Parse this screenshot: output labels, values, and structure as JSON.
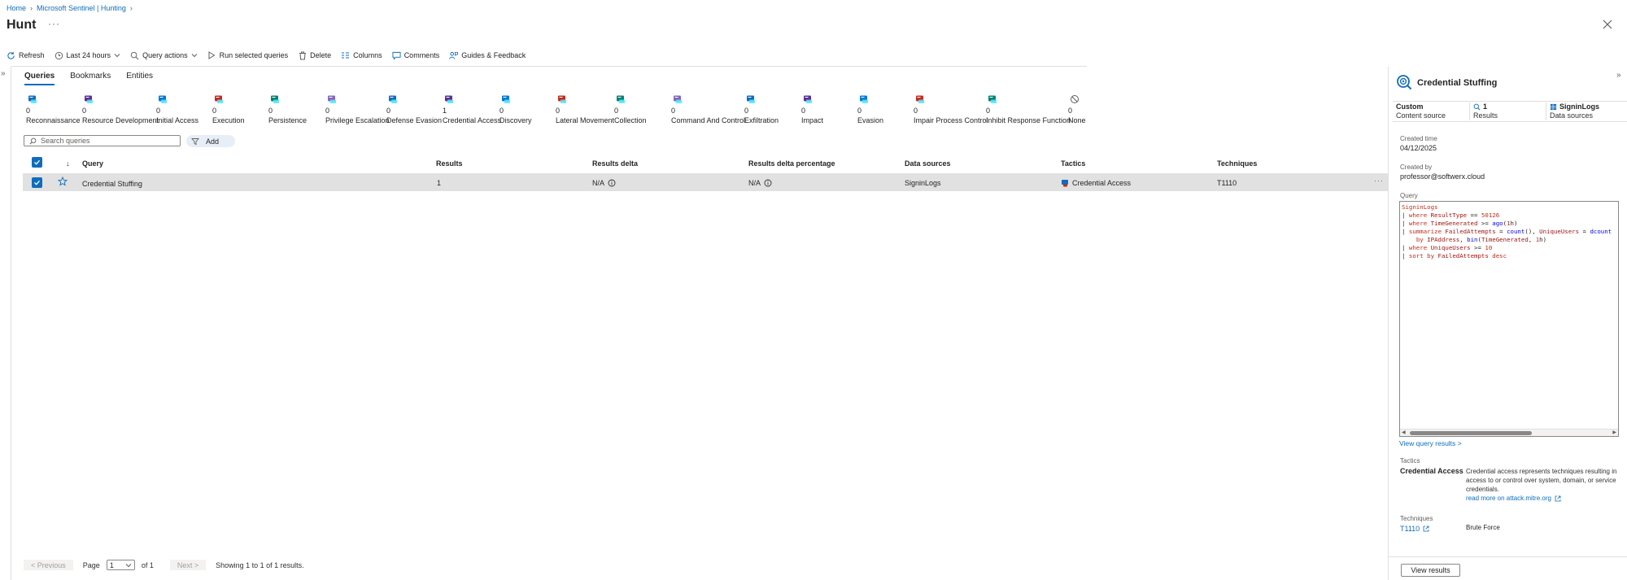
{
  "breadcrumb": {
    "home": "Home",
    "sentinel": "Microsoft Sentinel | Hunting"
  },
  "page": {
    "title": "Hunt",
    "more": "···"
  },
  "toolbar": {
    "refresh": "Refresh",
    "time_range": "Last 24 hours",
    "query_actions": "Query actions",
    "run_selected": "Run selected queries",
    "delete": "Delete",
    "columns": "Columns",
    "comments": "Comments",
    "guides": "Guides & Feedback"
  },
  "tabs": [
    "Queries",
    "Bookmarks",
    "Entities"
  ],
  "tactics": [
    {
      "count": "0",
      "name": "Reconnaissance",
      "icon": "reconnaissance-icon"
    },
    {
      "count": "0",
      "name": "Resource Development",
      "icon": "resource-development-icon"
    },
    {
      "count": "0",
      "name": "Initial Access",
      "icon": "initial-access-icon"
    },
    {
      "count": "0",
      "name": "Execution",
      "icon": "execution-icon"
    },
    {
      "count": "0",
      "name": "Persistence",
      "icon": "persistence-icon"
    },
    {
      "count": "0",
      "name": "Privilege Escalation",
      "icon": "privilege-escalation-icon"
    },
    {
      "count": "0",
      "name": "Defense Evasion",
      "icon": "defense-evasion-icon"
    },
    {
      "count": "1",
      "name": "Credential Access",
      "icon": "credential-access-icon"
    },
    {
      "count": "0",
      "name": "Discovery",
      "icon": "discovery-icon"
    },
    {
      "count": "0",
      "name": "Lateral Movement",
      "icon": "lateral-movement-icon"
    },
    {
      "count": "0",
      "name": "Collection",
      "icon": "collection-icon"
    },
    {
      "count": "0",
      "name": "Command And Control",
      "icon": "command-and-control-icon"
    },
    {
      "count": "0",
      "name": "Exfiltration",
      "icon": "exfiltration-icon"
    },
    {
      "count": "0",
      "name": "Impact",
      "icon": "impact-icon"
    },
    {
      "count": "0",
      "name": "Evasion",
      "icon": "evasion-icon"
    },
    {
      "count": "0",
      "name": "Impair Process Control",
      "icon": "impair-process-control-icon"
    },
    {
      "count": "0",
      "name": "Inhibit Response Function",
      "icon": "inhibit-response-function-icon"
    },
    {
      "count": "0",
      "name": "None",
      "icon": "none-icon"
    }
  ],
  "search": {
    "placeholder": "Search queries",
    "add_filter": "Add"
  },
  "table": {
    "sort_indicator": "↓",
    "columns": [
      "Query",
      "Results",
      "Results delta",
      "Results delta percentage",
      "Data sources",
      "Tactics",
      "Techniques"
    ],
    "rows": [
      {
        "query": "Credential Stuffing",
        "results": "1",
        "results_delta": "N/A",
        "results_delta_percentage": "N/A",
        "data_sources": "SigninLogs",
        "tactics": "Credential Access",
        "techniques": "T1110",
        "more": "···"
      }
    ]
  },
  "pagination": {
    "previous": "< Previous",
    "page_label": "Page",
    "page_value": "1",
    "of_label": "of 1",
    "next": "Next >",
    "summary": "Showing 1 to 1 of 1 results."
  },
  "details": {
    "title": "Credential Stuffing",
    "content_source_value": "Custom",
    "content_source_label": "Content source",
    "results_value": "1",
    "results_label": "Results",
    "data_sources_value": "SigninLogs",
    "data_sources_label": "Data sources",
    "created_time_label": "Created time",
    "created_time": "04/12/2025",
    "created_by_label": "Created by",
    "created_by": "professor@softwerx.cloud",
    "query_label": "Query",
    "view_query_results": "View query results >",
    "tactics_label": "Tactics",
    "tactic_name": "Credential Access",
    "tactic_description": "Credential access represents techniques resulting in access to or control over system, domain, or service credentials.",
    "tactic_link": "read more on attack.mitre.org",
    "techniques_label": "Techniques",
    "technique_id": "T1110",
    "technique_name": "Brute Force",
    "view_results": "View results"
  },
  "query_code": [
    "SigninLogs",
    "| where ResultType == 50126",
    "| where TimeGenerated >= ago(1h)",
    "| summarize FailedAttempts = count(), UniqueUsers = dcount",
    "    by IPAddress, bin(TimeGenerated, 1h)",
    "| where UniqueUsers >= 10",
    "| sort by FailedAttempts desc"
  ],
  "colors": {
    "accent": "#0f6cbd",
    "selected_row": "#e1e1e1",
    "keyword": "#c42b1c",
    "function": "#0000ff"
  }
}
